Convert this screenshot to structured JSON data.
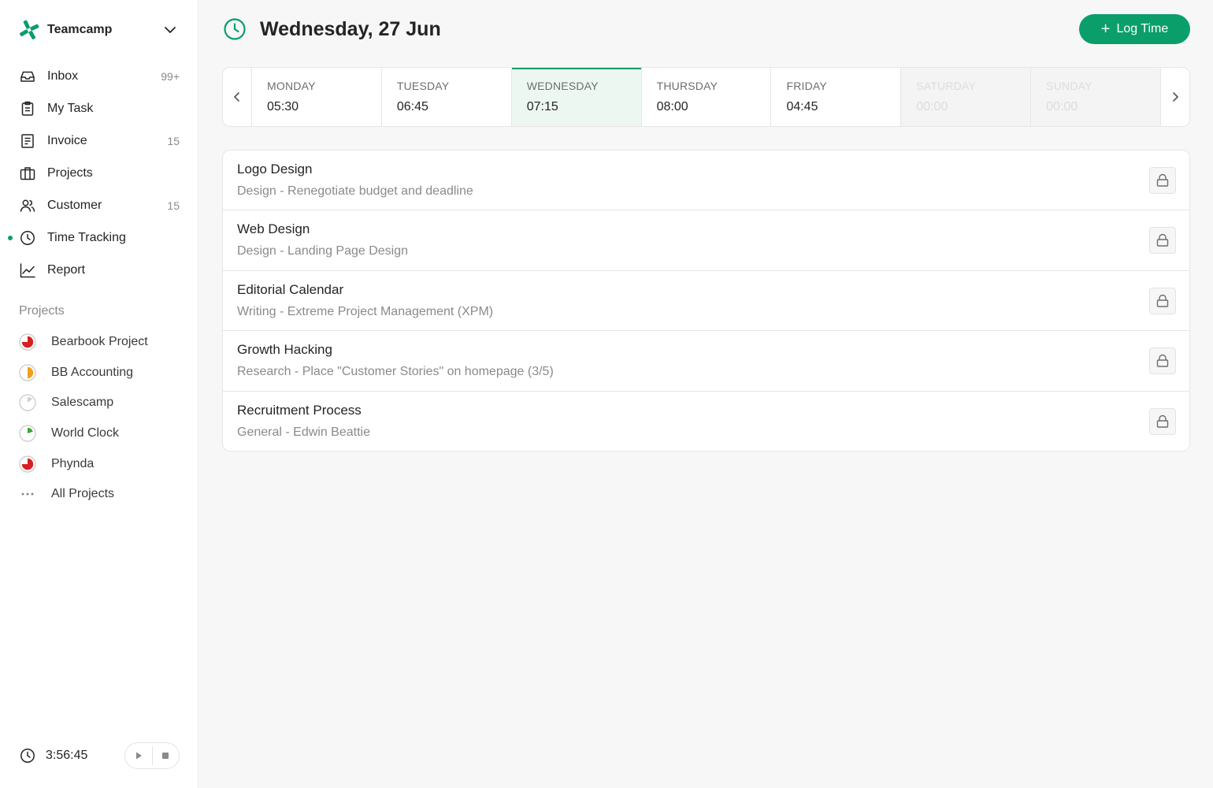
{
  "brand": {
    "name": "Teamcamp",
    "accent": "#0a9e6a"
  },
  "nav": [
    {
      "label": "Inbox",
      "count": "99+",
      "icon": "inbox-icon"
    },
    {
      "label": "My Task",
      "count": "",
      "icon": "clipboard-icon"
    },
    {
      "label": "Invoice",
      "count": "15",
      "icon": "invoice-icon"
    },
    {
      "label": "Projects",
      "count": "",
      "icon": "briefcase-icon"
    },
    {
      "label": "Customer",
      "count": "15",
      "icon": "users-icon"
    },
    {
      "label": "Time Tracking",
      "count": "",
      "icon": "clock-icon",
      "active": true
    },
    {
      "label": "Report",
      "count": "",
      "icon": "chart-line-icon"
    }
  ],
  "projects": {
    "heading": "Projects",
    "items": [
      {
        "label": "Bearbook Project",
        "progress": 0.75,
        "color": "#d62020"
      },
      {
        "label": "BB Accounting",
        "progress": 0.5,
        "color": "#f0a020"
      },
      {
        "label": "Salescamp",
        "progress": 0.15,
        "color": "#d0d0d0"
      },
      {
        "label": "World Clock",
        "progress": 0.2,
        "color": "#3aa832"
      },
      {
        "label": "Phynda",
        "progress": 0.75,
        "color": "#d62020"
      }
    ],
    "all_label": "All Projects"
  },
  "timer": {
    "time": "3:56:45"
  },
  "header": {
    "title": "Wednesday, 27 Jun",
    "log_button": "Log Time"
  },
  "week": [
    {
      "name": "MONDAY",
      "time": "05:30",
      "state": "normal"
    },
    {
      "name": "TUESDAY",
      "time": "06:45",
      "state": "normal"
    },
    {
      "name": "WEDNESDAY",
      "time": "07:15",
      "state": "active"
    },
    {
      "name": "THURSDAY",
      "time": "08:00",
      "state": "normal"
    },
    {
      "name": "FRIDAY",
      "time": "04:45",
      "state": "normal"
    },
    {
      "name": "SATURDAY",
      "time": "00:00",
      "state": "off"
    },
    {
      "name": "SUNDAY",
      "time": "00:00",
      "state": "off"
    }
  ],
  "entries": [
    {
      "title": "Logo Design",
      "subtitle": "Design - Renegotiate budget and deadline"
    },
    {
      "title": "Web Design",
      "subtitle": "Design - Landing Page Design"
    },
    {
      "title": "Editorial Calendar",
      "subtitle": "Writing - Extreme Project Management (XPM)"
    },
    {
      "title": "Growth Hacking",
      "subtitle": "Research - Place \"Customer Stories\" on homepage (3/5)"
    },
    {
      "title": "Recruitment Process",
      "subtitle": "General - Edwin Beattie"
    }
  ]
}
